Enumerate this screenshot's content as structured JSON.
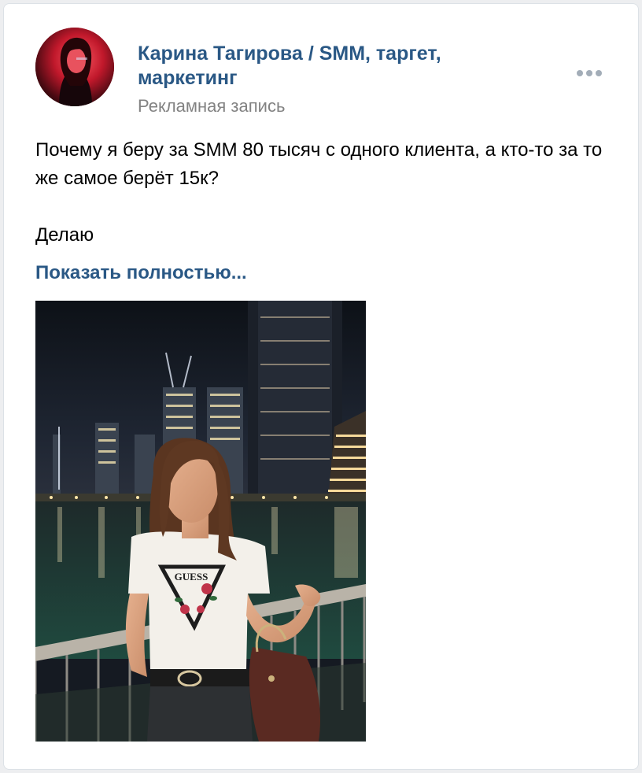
{
  "post": {
    "author": "Карина Тагирова / SMM, таргет, маркетинг",
    "subtitle": "Рекламная запись",
    "text_line1": "Почему я беру за SMM 80 тысяч с одного клиента, а кто-то за то же самое берёт 15к?",
    "text_line2": "Делаю",
    "show_more": "Показать полностью...",
    "shirt_brand": "GUESS",
    "more_icon": "ellipsis-icon"
  },
  "colors": {
    "link": "#2a5885",
    "secondary_text": "#828282",
    "background": "#edeef0",
    "card": "#ffffff"
  }
}
